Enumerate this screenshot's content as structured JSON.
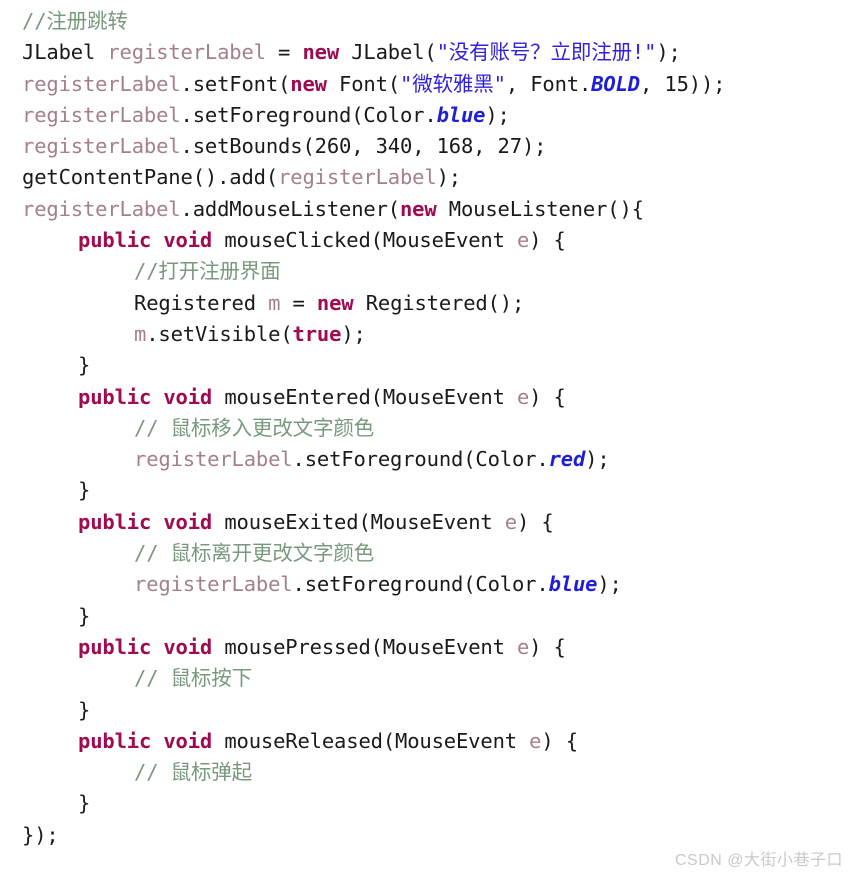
{
  "editor": {
    "language": "Java",
    "background_color": "#ffffff",
    "font_size_px": 20.5,
    "line_height_px": 31.3,
    "palette": {
      "plain": "#1a1a1a",
      "comment": "#78997e",
      "keyword": "#9e0b50",
      "variable": "#a3808c",
      "string": "#3322dd",
      "static_field": "#1f1fd8",
      "watermark": "#c9c9c9"
    }
  },
  "lines": [
    {
      "n": 1,
      "indent": 0,
      "tokens": [
        {
          "t": "comment",
          "v": "//注册跳转"
        }
      ]
    },
    {
      "n": 2,
      "indent": 0,
      "tokens": [
        {
          "t": "type",
          "v": "JLabel"
        },
        {
          "t": "plain",
          "v": " "
        },
        {
          "t": "var",
          "v": "registerLabel"
        },
        {
          "t": "plain",
          "v": " = "
        },
        {
          "t": "keyword",
          "v": "new"
        },
        {
          "t": "plain",
          "v": " "
        },
        {
          "t": "type",
          "v": "JLabel"
        },
        {
          "t": "punct",
          "v": "("
        },
        {
          "t": "string",
          "v": "\"没有账号？立即注册!\""
        },
        {
          "t": "punct",
          "v": ");"
        }
      ]
    },
    {
      "n": 3,
      "indent": 0,
      "tokens": [
        {
          "t": "var",
          "v": "registerLabel"
        },
        {
          "t": "plain",
          "v": "."
        },
        {
          "t": "method",
          "v": "setFont"
        },
        {
          "t": "punct",
          "v": "("
        },
        {
          "t": "keyword",
          "v": "new"
        },
        {
          "t": "plain",
          "v": " "
        },
        {
          "t": "type",
          "v": "Font"
        },
        {
          "t": "punct",
          "v": "("
        },
        {
          "t": "string",
          "v": "\"微软雅黑\""
        },
        {
          "t": "punct",
          "v": ", "
        },
        {
          "t": "type",
          "v": "Font"
        },
        {
          "t": "plain",
          "v": "."
        },
        {
          "t": "static",
          "v": "BOLD"
        },
        {
          "t": "punct",
          "v": ", "
        },
        {
          "t": "num",
          "v": "15"
        },
        {
          "t": "punct",
          "v": "));"
        }
      ]
    },
    {
      "n": 4,
      "indent": 0,
      "tokens": [
        {
          "t": "var",
          "v": "registerLabel"
        },
        {
          "t": "plain",
          "v": "."
        },
        {
          "t": "method",
          "v": "setForeground"
        },
        {
          "t": "punct",
          "v": "("
        },
        {
          "t": "type",
          "v": "Color"
        },
        {
          "t": "plain",
          "v": "."
        },
        {
          "t": "static",
          "v": "blue"
        },
        {
          "t": "punct",
          "v": ");"
        }
      ]
    },
    {
      "n": 5,
      "indent": 0,
      "tokens": [
        {
          "t": "var",
          "v": "registerLabel"
        },
        {
          "t": "plain",
          "v": "."
        },
        {
          "t": "method",
          "v": "setBounds"
        },
        {
          "t": "punct",
          "v": "("
        },
        {
          "t": "num",
          "v": "260"
        },
        {
          "t": "punct",
          "v": ", "
        },
        {
          "t": "num",
          "v": "340"
        },
        {
          "t": "punct",
          "v": ", "
        },
        {
          "t": "num",
          "v": "168"
        },
        {
          "t": "punct",
          "v": ", "
        },
        {
          "t": "num",
          "v": "27"
        },
        {
          "t": "punct",
          "v": ");"
        }
      ]
    },
    {
      "n": 6,
      "indent": 0,
      "tokens": [
        {
          "t": "method",
          "v": "getContentPane"
        },
        {
          "t": "punct",
          "v": "()."
        },
        {
          "t": "method",
          "v": "add"
        },
        {
          "t": "punct",
          "v": "("
        },
        {
          "t": "var",
          "v": "registerLabel"
        },
        {
          "t": "punct",
          "v": ");"
        }
      ]
    },
    {
      "n": 7,
      "indent": 0,
      "tokens": [
        {
          "t": "var",
          "v": "registerLabel"
        },
        {
          "t": "plain",
          "v": "."
        },
        {
          "t": "method",
          "v": "addMouseListener"
        },
        {
          "t": "punct",
          "v": "("
        },
        {
          "t": "keyword",
          "v": "new"
        },
        {
          "t": "plain",
          "v": " "
        },
        {
          "t": "type",
          "v": "MouseListener"
        },
        {
          "t": "punct",
          "v": "(){"
        }
      ]
    },
    {
      "n": 8,
      "indent": 1,
      "tokens": [
        {
          "t": "keyword",
          "v": "public void"
        },
        {
          "t": "plain",
          "v": " "
        },
        {
          "t": "method",
          "v": "mouseClicked"
        },
        {
          "t": "punct",
          "v": "("
        },
        {
          "t": "type",
          "v": "MouseEvent"
        },
        {
          "t": "plain",
          "v": " "
        },
        {
          "t": "var",
          "v": "e"
        },
        {
          "t": "punct",
          "v": ") {"
        }
      ]
    },
    {
      "n": 9,
      "indent": 2,
      "tokens": [
        {
          "t": "comment",
          "v": "//打开注册界面"
        }
      ]
    },
    {
      "n": 10,
      "indent": 2,
      "tokens": [
        {
          "t": "type",
          "v": "Registered"
        },
        {
          "t": "plain",
          "v": " "
        },
        {
          "t": "var",
          "v": "m"
        },
        {
          "t": "plain",
          "v": " = "
        },
        {
          "t": "keyword",
          "v": "new"
        },
        {
          "t": "plain",
          "v": " "
        },
        {
          "t": "type",
          "v": "Registered"
        },
        {
          "t": "punct",
          "v": "();"
        }
      ]
    },
    {
      "n": 11,
      "indent": 2,
      "tokens": [
        {
          "t": "var",
          "v": "m"
        },
        {
          "t": "plain",
          "v": "."
        },
        {
          "t": "method",
          "v": "setVisible"
        },
        {
          "t": "punct",
          "v": "("
        },
        {
          "t": "keyword",
          "v": "true"
        },
        {
          "t": "punct",
          "v": ");"
        }
      ]
    },
    {
      "n": 12,
      "indent": 1,
      "tokens": [
        {
          "t": "punct",
          "v": "}"
        }
      ]
    },
    {
      "n": 13,
      "indent": 1,
      "tokens": [
        {
          "t": "keyword",
          "v": "public void"
        },
        {
          "t": "plain",
          "v": " "
        },
        {
          "t": "method",
          "v": "mouseEntered"
        },
        {
          "t": "punct",
          "v": "("
        },
        {
          "t": "type",
          "v": "MouseEvent"
        },
        {
          "t": "plain",
          "v": " "
        },
        {
          "t": "var",
          "v": "e"
        },
        {
          "t": "punct",
          "v": ") {"
        }
      ]
    },
    {
      "n": 14,
      "indent": 2,
      "tokens": [
        {
          "t": "comment",
          "v": "// 鼠标移入更改文字颜色"
        }
      ]
    },
    {
      "n": 15,
      "indent": 2,
      "tokens": [
        {
          "t": "var",
          "v": "registerLabel"
        },
        {
          "t": "plain",
          "v": "."
        },
        {
          "t": "method",
          "v": "setForeground"
        },
        {
          "t": "punct",
          "v": "("
        },
        {
          "t": "type",
          "v": "Color"
        },
        {
          "t": "plain",
          "v": "."
        },
        {
          "t": "static",
          "v": "red"
        },
        {
          "t": "punct",
          "v": ");"
        }
      ]
    },
    {
      "n": 16,
      "indent": 1,
      "tokens": [
        {
          "t": "punct",
          "v": "}"
        }
      ]
    },
    {
      "n": 17,
      "indent": 1,
      "tokens": [
        {
          "t": "keyword",
          "v": "public void"
        },
        {
          "t": "plain",
          "v": " "
        },
        {
          "t": "method",
          "v": "mouseExited"
        },
        {
          "t": "punct",
          "v": "("
        },
        {
          "t": "type",
          "v": "MouseEvent"
        },
        {
          "t": "plain",
          "v": " "
        },
        {
          "t": "var",
          "v": "e"
        },
        {
          "t": "punct",
          "v": ") {"
        }
      ]
    },
    {
      "n": 18,
      "indent": 2,
      "tokens": [
        {
          "t": "comment",
          "v": "// 鼠标离开更改文字颜色"
        }
      ]
    },
    {
      "n": 19,
      "indent": 2,
      "tokens": [
        {
          "t": "var",
          "v": "registerLabel"
        },
        {
          "t": "plain",
          "v": "."
        },
        {
          "t": "method",
          "v": "setForeground"
        },
        {
          "t": "punct",
          "v": "("
        },
        {
          "t": "type",
          "v": "Color"
        },
        {
          "t": "plain",
          "v": "."
        },
        {
          "t": "static",
          "v": "blue"
        },
        {
          "t": "punct",
          "v": ");"
        }
      ]
    },
    {
      "n": 20,
      "indent": 1,
      "tokens": [
        {
          "t": "punct",
          "v": "}"
        }
      ]
    },
    {
      "n": 21,
      "indent": 1,
      "tokens": [
        {
          "t": "keyword",
          "v": "public void"
        },
        {
          "t": "plain",
          "v": " "
        },
        {
          "t": "method",
          "v": "mousePressed"
        },
        {
          "t": "punct",
          "v": "("
        },
        {
          "t": "type",
          "v": "MouseEvent"
        },
        {
          "t": "plain",
          "v": " "
        },
        {
          "t": "var",
          "v": "e"
        },
        {
          "t": "punct",
          "v": ") {"
        }
      ]
    },
    {
      "n": 22,
      "indent": 2,
      "tokens": [
        {
          "t": "comment",
          "v": "// 鼠标按下"
        }
      ]
    },
    {
      "n": 23,
      "indent": 1,
      "tokens": [
        {
          "t": "punct",
          "v": "}"
        }
      ]
    },
    {
      "n": 24,
      "indent": 1,
      "tokens": [
        {
          "t": "keyword",
          "v": "public void"
        },
        {
          "t": "plain",
          "v": " "
        },
        {
          "t": "method",
          "v": "mouseReleased"
        },
        {
          "t": "punct",
          "v": "("
        },
        {
          "t": "type",
          "v": "MouseEvent"
        },
        {
          "t": "plain",
          "v": " "
        },
        {
          "t": "var",
          "v": "e"
        },
        {
          "t": "punct",
          "v": ") {"
        }
      ]
    },
    {
      "n": 25,
      "indent": 2,
      "tokens": [
        {
          "t": "comment",
          "v": "// 鼠标弹起"
        }
      ]
    },
    {
      "n": 26,
      "indent": 1,
      "tokens": [
        {
          "t": "punct",
          "v": "}"
        }
      ]
    },
    {
      "n": 27,
      "indent": 0,
      "tokens": [
        {
          "t": "punct",
          "v": "});"
        }
      ]
    }
  ],
  "watermark": {
    "text": "CSDN @大街小巷子口"
  }
}
